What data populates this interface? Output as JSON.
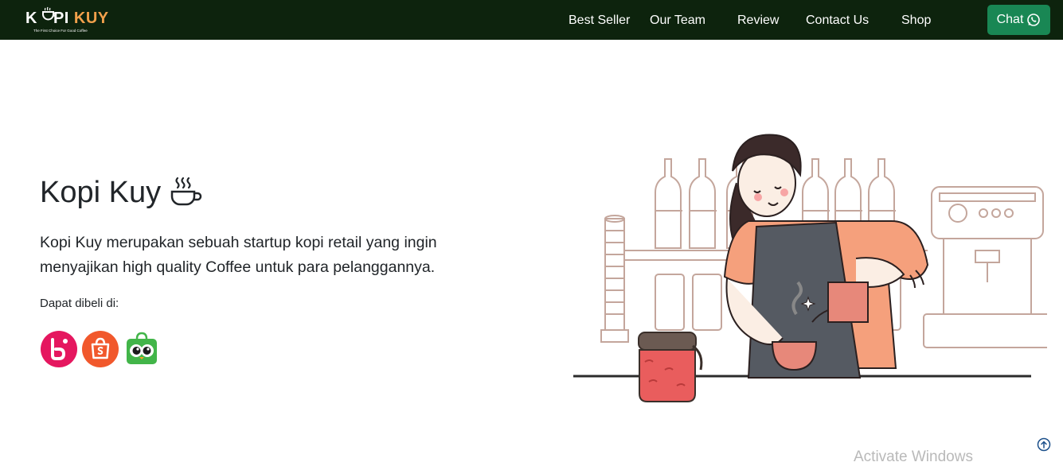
{
  "brand": {
    "left": "K",
    "middle": "PI ",
    "right": "KUY",
    "tagline": "The First Choice For Good Coffee"
  },
  "nav": {
    "items": [
      "Best Seller",
      "Our Team",
      "Review",
      "Contact Us",
      "Shop"
    ],
    "chat_label": "Chat"
  },
  "hero": {
    "title": "Kopi Kuy",
    "description": "Kopi Kuy merupakan sebuah startup kopi retail yang ingin menyajikan high quality Coffee untuk para pelanggannya.",
    "buy_label": "Dapat dibeli di:"
  },
  "stores": [
    {
      "name": "Blibli",
      "icon": "blibli-icon",
      "color": "#e5175f"
    },
    {
      "name": "Shopee",
      "icon": "shopee-icon",
      "color": "#f1582c"
    },
    {
      "name": "Tokopedia",
      "icon": "tokopedia-icon",
      "color": "#42b549"
    }
  ],
  "colors": {
    "navbar": "#0d230d",
    "accent": "#f0a04b",
    "chat_button": "#198754"
  },
  "system": {
    "watermark": "Activate Windows"
  }
}
